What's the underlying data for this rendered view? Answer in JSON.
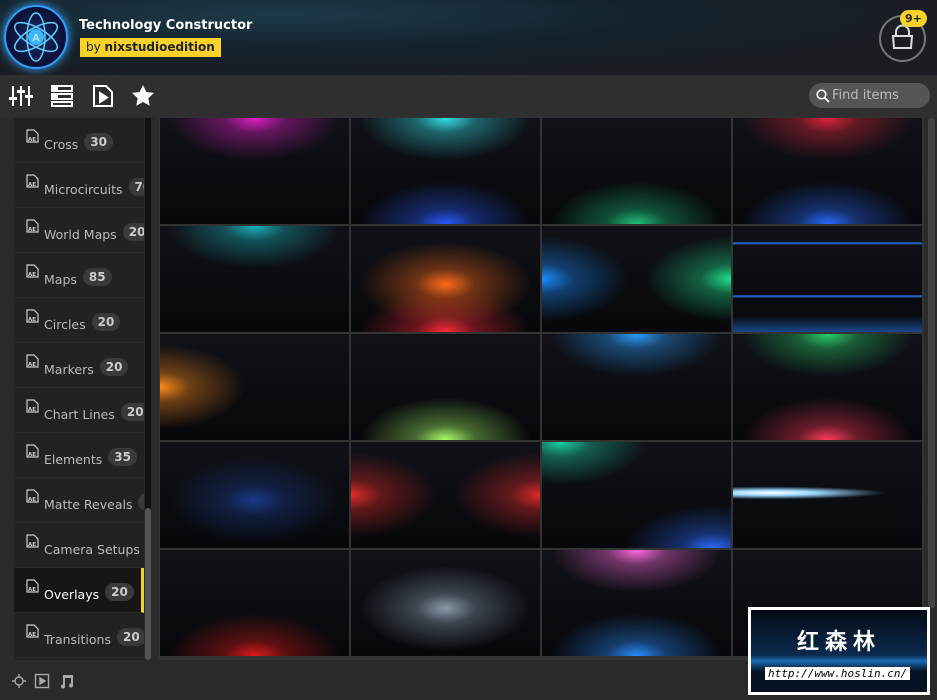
{
  "header": {
    "title": "Technology Constructor",
    "author_prefix": "by",
    "author": "nixstudioedition",
    "cart_badge": "9+",
    "logo_letter": "A"
  },
  "toolbar": {
    "icons": [
      "sliders-icon",
      "list-icon",
      "video-file-icon",
      "star-icon"
    ],
    "search_placeholder": "Find items"
  },
  "sidebar": {
    "items": [
      {
        "label": "Cross",
        "count": "30"
      },
      {
        "label": "Microcircuits",
        "count": "70"
      },
      {
        "label": "World Maps",
        "count": "20"
      },
      {
        "label": "Maps",
        "count": "85"
      },
      {
        "label": "Circles",
        "count": "20"
      },
      {
        "label": "Markers",
        "count": "20"
      },
      {
        "label": "Chart Lines",
        "count": "20"
      },
      {
        "label": "Elements",
        "count": "35"
      },
      {
        "label": "Matte Reveals",
        "count": "10"
      },
      {
        "label": "Camera Setups",
        "count": "20"
      },
      {
        "label": "Overlays",
        "count": "20",
        "active": true
      },
      {
        "label": "Transitions",
        "count": "20"
      }
    ]
  },
  "accent": "#f6d22a",
  "thumbnails": [
    [
      "#e21fc8",
      "top"
    ],
    [
      "#34e0e8",
      "top",
      "#2a5bff",
      "bottom"
    ],
    [
      "#1fc07a",
      "bottom"
    ],
    [
      "#e0243a",
      "top",
      "#2a6bff",
      "bottom"
    ],
    [
      "#1ab0b8",
      "top"
    ],
    [
      "#ff6a1a",
      "center",
      "#ff2a3a",
      "bottom"
    ],
    [
      "#1a8cff",
      "left",
      "#1fe08a",
      "right"
    ],
    [
      "#2a7fff",
      "lines"
    ],
    [
      "#ff8a1a",
      "left"
    ],
    [
      "#a8ff6a",
      "bottom"
    ],
    [
      "#2a9cff",
      "top"
    ],
    [
      "#2ad06a",
      "top",
      "#ff3a5a",
      "bottom"
    ],
    [
      "#1a3a8a",
      "center"
    ],
    [
      "#e02a2a",
      "left",
      "#e02a2a",
      "right"
    ],
    [
      "#1ad0a0",
      "top-left",
      "#2a6bff",
      "bottom-right"
    ],
    [
      "#9ad8ff",
      "streak"
    ],
    [
      "#e01a1a",
      "bottom"
    ],
    [
      "#8a9aaa",
      "center"
    ],
    [
      "#ff6ae0",
      "top",
      "#2a8cff",
      "bottom"
    ],
    [
      "#1a1a1a",
      "none"
    ]
  ],
  "bottom_bar": {
    "icons": [
      "3d-object-icon",
      "video-icon",
      "music-icon"
    ]
  },
  "watermark": {
    "text_cn": "红森林",
    "url": "http://www.hoslin.cn/"
  }
}
